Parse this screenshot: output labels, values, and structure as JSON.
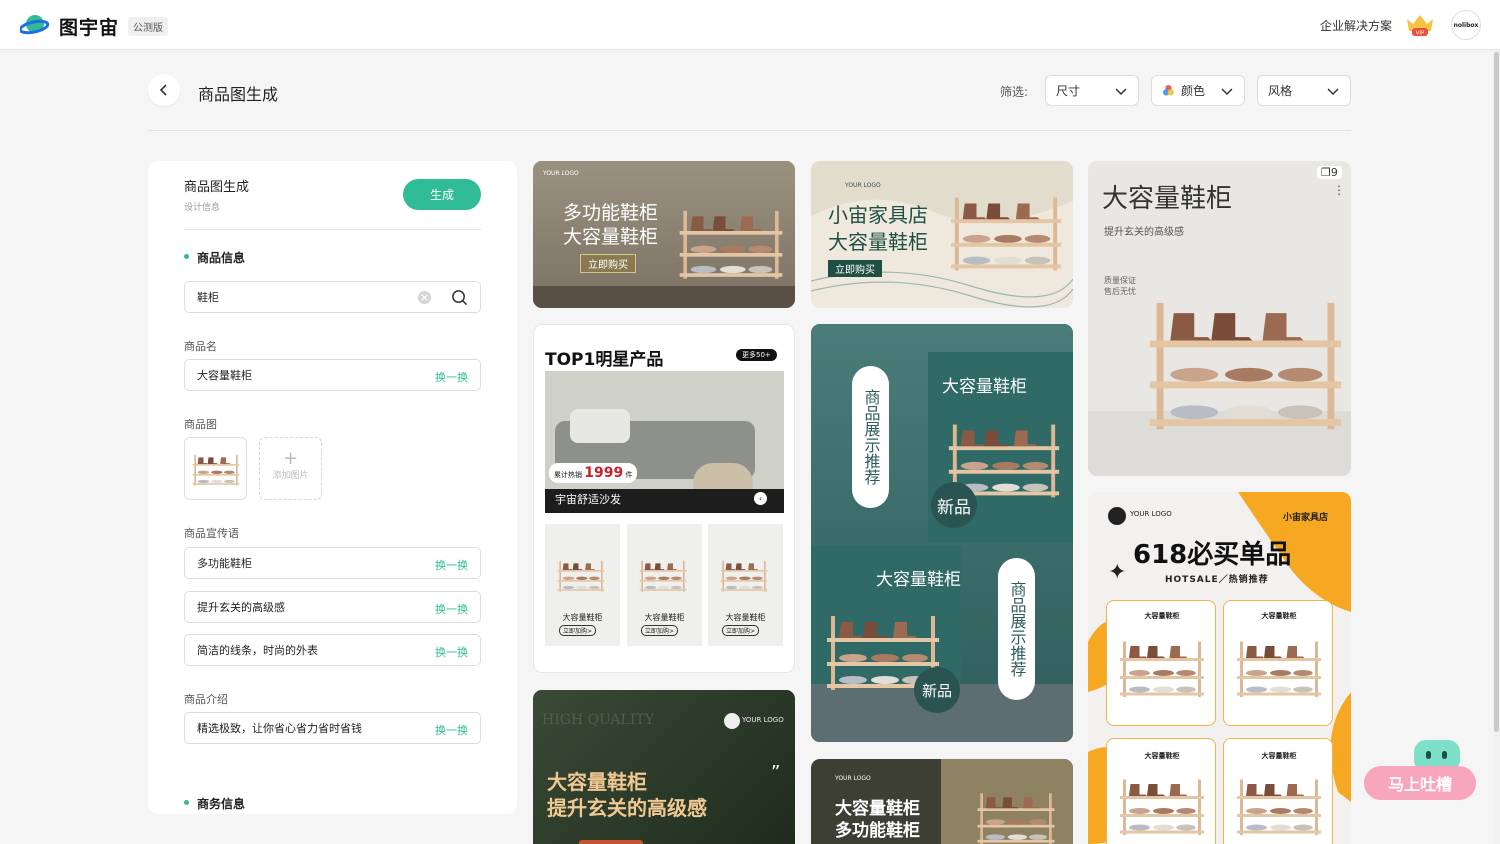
{
  "app": {
    "name": "图宇宙",
    "badge": "公测版",
    "enterprise": "企业解决方案",
    "vip_label": "VIP",
    "avatar_text": "nolibox"
  },
  "header": {
    "title": "商品图生成",
    "filter_label": "筛选:",
    "filters": [
      {
        "label": "尺寸",
        "icon": "chevron-down-icon"
      },
      {
        "label": "颜色",
        "icon": "color-wheel-icon"
      },
      {
        "label": "风格",
        "icon": "chevron-down-icon"
      }
    ]
  },
  "panel": {
    "title": "商品图生成",
    "subtitle": "设计信息",
    "generate": "生成",
    "section_product": "商品信息",
    "search_value": "鞋柜",
    "name_label": "商品名",
    "name_value": "大容量鞋柜",
    "swap": "换一换",
    "image_label": "商品图",
    "add_image": "添加图片",
    "slogan_label": "商品宣传语",
    "slogans": [
      "多功能鞋柜",
      "提升玄关的高级感",
      "简洁的线条，时尚的外表"
    ],
    "intro_label": "商品介绍",
    "intro_value": "精选极致，让你省心省力省时省钱",
    "section_business": "商务信息"
  },
  "cards": {
    "c1": {
      "logo": "YOUR LOGO",
      "line1": "多功能鞋柜",
      "line2": "大容量鞋柜",
      "cta": "立即购买"
    },
    "c2": {
      "logo": "YOUR LOGO",
      "line1": "小宙家具店",
      "line2": "大容量鞋柜",
      "cta": "立即购买"
    },
    "c3": {
      "title": "大容量鞋柜",
      "sub": "提升玄关的高级感",
      "note1": "质量保证",
      "note2": "售后无忧",
      "count": "9"
    },
    "c4": {
      "title": "TOP1明星产品",
      "more": "更多50+",
      "sales_label": "累计热销",
      "sales": "1999",
      "sales_unit": "件",
      "product": "宇宙舒适沙发",
      "items": [
        {
          "name": "大容量鞋柜",
          "btn": "立即加购>"
        },
        {
          "name": "大容量鞋柜",
          "btn": "立即加购>"
        },
        {
          "name": "大容量鞋柜",
          "btn": "立即加购>"
        }
      ]
    },
    "c5": {
      "vertical": "商品展示推荐",
      "title": "大容量鞋柜",
      "tag": "新品"
    },
    "c6": {
      "logo": "YOUR LOGO",
      "shop": "小宙家具店",
      "title": "618必买单品",
      "sub": "HOTSALE／热销推荐",
      "item": "大容量鞋柜"
    },
    "c7": {
      "bg_text": "HIGH QUALITY",
      "logo": "YOUR LOGO",
      "line1": "大容量鞋柜",
      "line2": "提升玄关的高级感"
    },
    "c8": {
      "logo": "YOUR LOGO",
      "line1": "大容量鞋柜",
      "line2": "多功能鞋柜"
    }
  },
  "feedback": {
    "label": "马上吐槽"
  },
  "colors": {
    "accent": "#2fbc96",
    "pink": "#f7a6bd",
    "orange": "#f7a823"
  }
}
